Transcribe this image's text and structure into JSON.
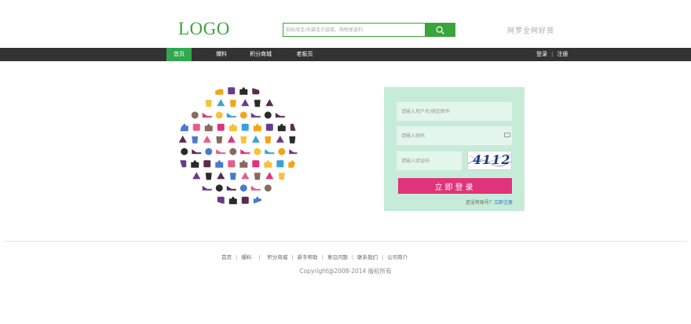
{
  "header": {
    "logo": "LOGO",
    "search": {
      "placeholder": "粘贴淘宝/天猫宝贝链接，购物享返利"
    },
    "slogan": "网罗全网好货"
  },
  "nav": {
    "items": [
      "首页",
      "爆料",
      "积分商城",
      "老板页"
    ],
    "login": "登录",
    "separator": "|",
    "register": "注册"
  },
  "login": {
    "username_placeholder": "请输入用户名/绑定邮件",
    "password_placeholder": "请输入密码",
    "captcha_placeholder": "请输入验证码",
    "captcha_text": "4112",
    "submit": "立即登录",
    "no_account": "还没有账号？",
    "register_link": "立即注册"
  },
  "footer": {
    "links": [
      "首页",
      "爆料",
      "积分商城",
      "新手帮助",
      "意见问题",
      "联系我们",
      "公司简介"
    ],
    "separator": "|",
    "copyright": "Copyright@2008-2014 版权所有"
  },
  "colors": {
    "brand_green": "#3aa53a",
    "nav_active": "#2fa84f",
    "nav_bg": "#333333",
    "login_bg": "#c6ecd9",
    "login_button": "#e0337a"
  }
}
